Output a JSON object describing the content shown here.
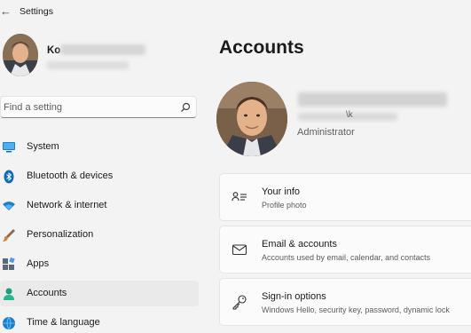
{
  "window": {
    "title": "Settings"
  },
  "user": {
    "name_visible": "Ko"
  },
  "search": {
    "placeholder": "Find a setting"
  },
  "nav": [
    {
      "label": "System",
      "icon": "monitor-icon",
      "color": "#0a6cbf"
    },
    {
      "label": "Bluetooth & devices",
      "icon": "bluetooth-icon",
      "color": "#0a6cbf"
    },
    {
      "label": "Network & internet",
      "icon": "wifi-icon",
      "color": "#1a7ed1"
    },
    {
      "label": "Personalization",
      "icon": "brush-icon",
      "color": "#d87b2a"
    },
    {
      "label": "Apps",
      "icon": "apps-icon",
      "color": "#4a5b6e"
    },
    {
      "label": "Accounts",
      "icon": "person-icon",
      "color": "#1c9e7a",
      "active": true
    },
    {
      "label": "Time & language",
      "icon": "globe-clock-icon",
      "color": "#1a7ed1"
    }
  ],
  "page": {
    "title": "Accounts"
  },
  "profile": {
    "sub_text": "\\k",
    "role": "Administrator"
  },
  "cards": [
    {
      "title": "Your info",
      "subtitle": "Profile photo",
      "icon": "person-card-icon"
    },
    {
      "title": "Email & accounts",
      "subtitle": "Accounts used by email, calendar, and contacts",
      "icon": "mail-icon"
    },
    {
      "title": "Sign-in options",
      "subtitle": "Windows Hello, security key, password, dynamic lock",
      "icon": "key-icon"
    }
  ],
  "colors": {
    "accent": "#0067c0",
    "background": "#f3f3f3",
    "card": "#fbfbfb"
  }
}
